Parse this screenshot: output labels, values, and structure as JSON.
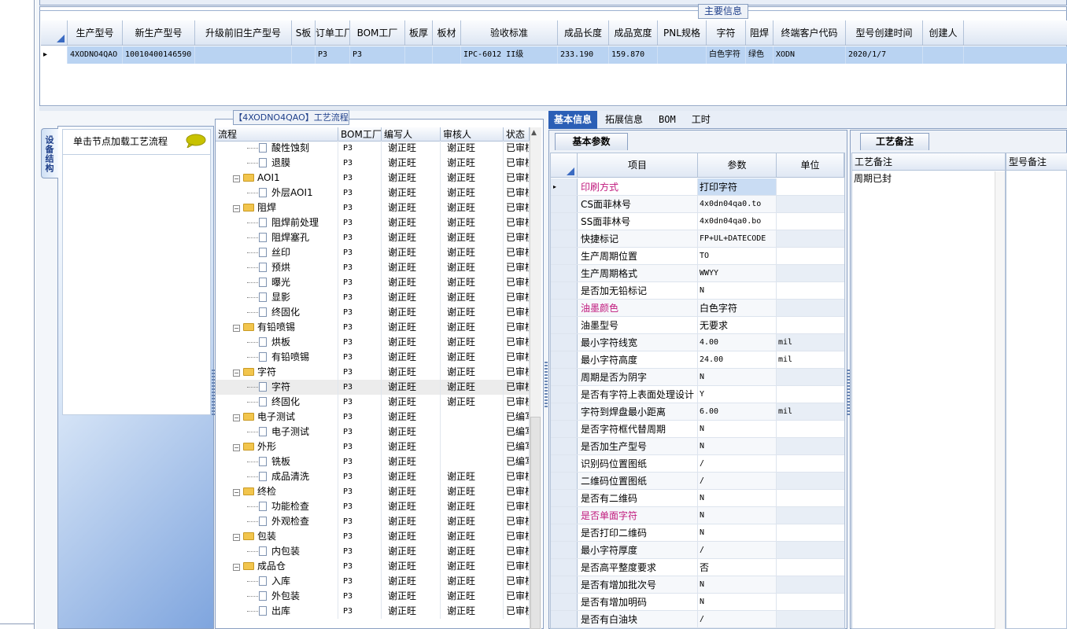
{
  "top_panel": {
    "title": "主要信息",
    "columns": [
      "生产型号",
      "新生产型号",
      "升级前旧生产型号",
      "S板",
      "订单工厂",
      "BOM工厂",
      "板厚",
      "板材",
      "验收标准",
      "成品长度",
      "成品宽度",
      "PNL规格",
      "字符",
      "阻焊",
      "终端客户代码",
      "型号创建时间",
      "创建人"
    ],
    "row": [
      "4XODNO4QAO",
      "10010400146590",
      "",
      "",
      "P3",
      "P3",
      "",
      "",
      "IPC-6012 II级",
      "233.190",
      "159.870",
      "",
      "白色字符",
      "绿色",
      "XODN",
      "2020/1/7",
      ""
    ]
  },
  "left_panel": {
    "vertical_tab": "设备结构",
    "hint": "单击节点加载工艺流程"
  },
  "process_panel": {
    "title": "【4XODNO4QAO】工艺流程",
    "columns": [
      "流程",
      "BOM工厂",
      "编写人",
      "审核人",
      "状态"
    ],
    "rows": [
      {
        "level": 2,
        "name": "酸性蚀刻",
        "bom": "P3",
        "writer": "谢正旺",
        "reviewer": "谢正旺",
        "status": "已审核"
      },
      {
        "level": 2,
        "name": "退膜",
        "bom": "P3",
        "writer": "谢正旺",
        "reviewer": "谢正旺",
        "status": "已审核"
      },
      {
        "level": 1,
        "name": "AOI1",
        "bom": "P3",
        "writer": "谢正旺",
        "reviewer": "谢正旺",
        "status": "已审核"
      },
      {
        "level": 2,
        "name": "外层AOI1",
        "bom": "P3",
        "writer": "谢正旺",
        "reviewer": "谢正旺",
        "status": "已审核"
      },
      {
        "level": 1,
        "name": "阻焊",
        "bom": "P3",
        "writer": "谢正旺",
        "reviewer": "谢正旺",
        "status": "已审核"
      },
      {
        "level": 2,
        "name": "阻焊前处理",
        "bom": "P3",
        "writer": "谢正旺",
        "reviewer": "谢正旺",
        "status": "已审核"
      },
      {
        "level": 2,
        "name": "阻焊塞孔",
        "bom": "P3",
        "writer": "谢正旺",
        "reviewer": "谢正旺",
        "status": "已审核"
      },
      {
        "level": 2,
        "name": "丝印",
        "bom": "P3",
        "writer": "谢正旺",
        "reviewer": "谢正旺",
        "status": "已审核"
      },
      {
        "level": 2,
        "name": "预烘",
        "bom": "P3",
        "writer": "谢正旺",
        "reviewer": "谢正旺",
        "status": "已审核"
      },
      {
        "level": 2,
        "name": "曝光",
        "bom": "P3",
        "writer": "谢正旺",
        "reviewer": "谢正旺",
        "status": "已审核"
      },
      {
        "level": 2,
        "name": "显影",
        "bom": "P3",
        "writer": "谢正旺",
        "reviewer": "谢正旺",
        "status": "已审核"
      },
      {
        "level": 2,
        "name": "终固化",
        "bom": "P3",
        "writer": "谢正旺",
        "reviewer": "谢正旺",
        "status": "已审核"
      },
      {
        "level": 1,
        "name": "有铅喷锡",
        "bom": "P3",
        "writer": "谢正旺",
        "reviewer": "谢正旺",
        "status": "已审核"
      },
      {
        "level": 2,
        "name": "烘板",
        "bom": "P3",
        "writer": "谢正旺",
        "reviewer": "谢正旺",
        "status": "已审核"
      },
      {
        "level": 2,
        "name": "有铅喷锡",
        "bom": "P3",
        "writer": "谢正旺",
        "reviewer": "谢正旺",
        "status": "已审核"
      },
      {
        "level": 1,
        "name": "字符",
        "bom": "P3",
        "writer": "谢正旺",
        "reviewer": "谢正旺",
        "status": "已审核"
      },
      {
        "level": 2,
        "name": "字符",
        "bom": "P3",
        "writer": "谢正旺",
        "reviewer": "谢正旺",
        "status": "已审核",
        "selected": true
      },
      {
        "level": 2,
        "name": "终固化",
        "bom": "P3",
        "writer": "谢正旺",
        "reviewer": "谢正旺",
        "status": "已审核"
      },
      {
        "level": 1,
        "name": "电子测试",
        "bom": "P3",
        "writer": "谢正旺",
        "reviewer": "",
        "status": "已编写"
      },
      {
        "level": 2,
        "name": "电子测试",
        "bom": "P3",
        "writer": "谢正旺",
        "reviewer": "",
        "status": "已编写"
      },
      {
        "level": 1,
        "name": "外形",
        "bom": "P3",
        "writer": "谢正旺",
        "reviewer": "",
        "status": "已编写"
      },
      {
        "level": 2,
        "name": "铣板",
        "bom": "P3",
        "writer": "谢正旺",
        "reviewer": "",
        "status": "已编写"
      },
      {
        "level": 2,
        "name": "成品清洗",
        "bom": "P3",
        "writer": "谢正旺",
        "reviewer": "谢正旺",
        "status": "已审核"
      },
      {
        "level": 1,
        "name": "终检",
        "bom": "P3",
        "writer": "谢正旺",
        "reviewer": "谢正旺",
        "status": "已审核"
      },
      {
        "level": 2,
        "name": "功能检查",
        "bom": "P3",
        "writer": "谢正旺",
        "reviewer": "谢正旺",
        "status": "已审核"
      },
      {
        "level": 2,
        "name": "外观检查",
        "bom": "P3",
        "writer": "谢正旺",
        "reviewer": "谢正旺",
        "status": "已审核"
      },
      {
        "level": 1,
        "name": "包装",
        "bom": "P3",
        "writer": "谢正旺",
        "reviewer": "谢正旺",
        "status": "已审核"
      },
      {
        "level": 2,
        "name": "内包装",
        "bom": "P3",
        "writer": "谢正旺",
        "reviewer": "谢正旺",
        "status": "已审核"
      },
      {
        "level": 1,
        "name": "成品仓",
        "bom": "P3",
        "writer": "谢正旺",
        "reviewer": "谢正旺",
        "status": "已审核"
      },
      {
        "level": 2,
        "name": "入库",
        "bom": "P3",
        "writer": "谢正旺",
        "reviewer": "谢正旺",
        "status": "已审核"
      },
      {
        "level": 2,
        "name": "外包装",
        "bom": "P3",
        "writer": "谢正旺",
        "reviewer": "谢正旺",
        "status": "已审核"
      },
      {
        "level": 2,
        "name": "出库",
        "bom": "P3",
        "writer": "谢正旺",
        "reviewer": "谢正旺",
        "status": "已审核"
      }
    ]
  },
  "tabs": [
    "基本信息",
    "拓展信息",
    "BOM",
    "工时"
  ],
  "basic_panel": {
    "tab": "基本参数",
    "columns": [
      "项目",
      "参数",
      "单位"
    ],
    "rows": [
      {
        "item": "印刷方式",
        "value": "打印字符",
        "unit": "",
        "highlight": true,
        "current": true
      },
      {
        "item": "CS面菲林号",
        "value": "4x0dn04qa0.to",
        "unit": ""
      },
      {
        "item": "SS面菲林号",
        "value": "4x0dn04qa0.bo",
        "unit": ""
      },
      {
        "item": "快捷标记",
        "value": "FP+UL+DATECODE",
        "unit": ""
      },
      {
        "item": "生产周期位置",
        "value": "TO",
        "unit": ""
      },
      {
        "item": "生产周期格式",
        "value": "WWYY",
        "unit": ""
      },
      {
        "item": "是否加无铅标记",
        "value": "N",
        "unit": ""
      },
      {
        "item": "油墨颜色",
        "value": "白色字符",
        "unit": "",
        "highlight": true
      },
      {
        "item": "油墨型号",
        "value": "无要求",
        "unit": ""
      },
      {
        "item": "最小字符线宽",
        "value": "4.00",
        "unit": "mil"
      },
      {
        "item": "最小字符高度",
        "value": "24.00",
        "unit": "mil"
      },
      {
        "item": "周期是否为阴字",
        "value": "N",
        "unit": ""
      },
      {
        "item": "是否有字符上表面处理设计",
        "value": "Y",
        "unit": ""
      },
      {
        "item": "字符到焊盘最小距离",
        "value": "6.00",
        "unit": "mil"
      },
      {
        "item": "是否字符框代替周期",
        "value": "N",
        "unit": ""
      },
      {
        "item": "是否加生产型号",
        "value": "N",
        "unit": ""
      },
      {
        "item": "识别码位置图纸",
        "value": "/",
        "unit": ""
      },
      {
        "item": "二维码位置图纸",
        "value": "/",
        "unit": ""
      },
      {
        "item": "是否有二维码",
        "value": "N",
        "unit": ""
      },
      {
        "item": "是否单面字符",
        "value": "N",
        "unit": "",
        "highlight": true
      },
      {
        "item": "是否打印二维码",
        "value": "N",
        "unit": ""
      },
      {
        "item": "最小字符厚度",
        "value": "/",
        "unit": ""
      },
      {
        "item": "是否高平整度要求",
        "value": "否",
        "unit": ""
      },
      {
        "item": "是否有增加批次号",
        "value": "N",
        "unit": ""
      },
      {
        "item": "是否有增加明码",
        "value": "N",
        "unit": ""
      },
      {
        "item": "是否有白油块",
        "value": "/",
        "unit": ""
      }
    ]
  },
  "remark_panel": {
    "tab": "工艺备注",
    "col1": "工艺备注",
    "col2": "型号备注",
    "value": "周期已封"
  },
  "colors": {
    "accent": "#2b5fb6",
    "selected_row": "#b9d3f2",
    "highlight_text": "#c0197d"
  }
}
